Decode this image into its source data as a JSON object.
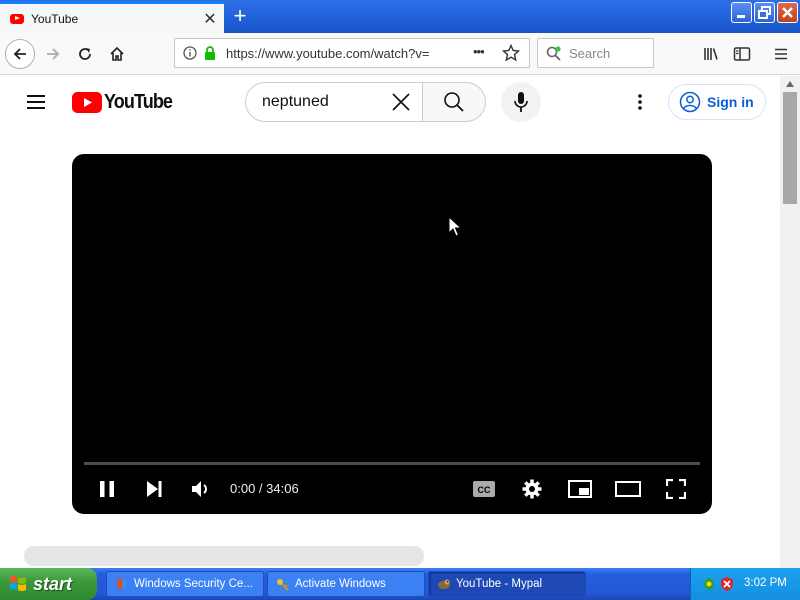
{
  "browser": {
    "tab_title": "YouTube",
    "tab_close": "✕",
    "new_tab": "+",
    "url": "https://www.youtube.com/watch?v=",
    "url_more": "•••",
    "search_placeholder": "Search"
  },
  "youtube": {
    "logo_text": "YouTube",
    "search_query": "neptuned",
    "sign_in": "Sign in",
    "player": {
      "time": "0:00 / 34:06",
      "progress_fraction": 0.0
    }
  },
  "taskbar": {
    "start_label": "start",
    "tasks": [
      {
        "label": "Windows Security Ce..."
      },
      {
        "label": "Activate Windows"
      },
      {
        "label": "YouTube - Mypal"
      }
    ],
    "clock": "3:02 PM"
  },
  "colors": {
    "youtube_red": "#ff0000",
    "link_blue": "#065fd4",
    "accent_tab": "#0a84ff",
    "loading_bar": "#e01b4b"
  }
}
